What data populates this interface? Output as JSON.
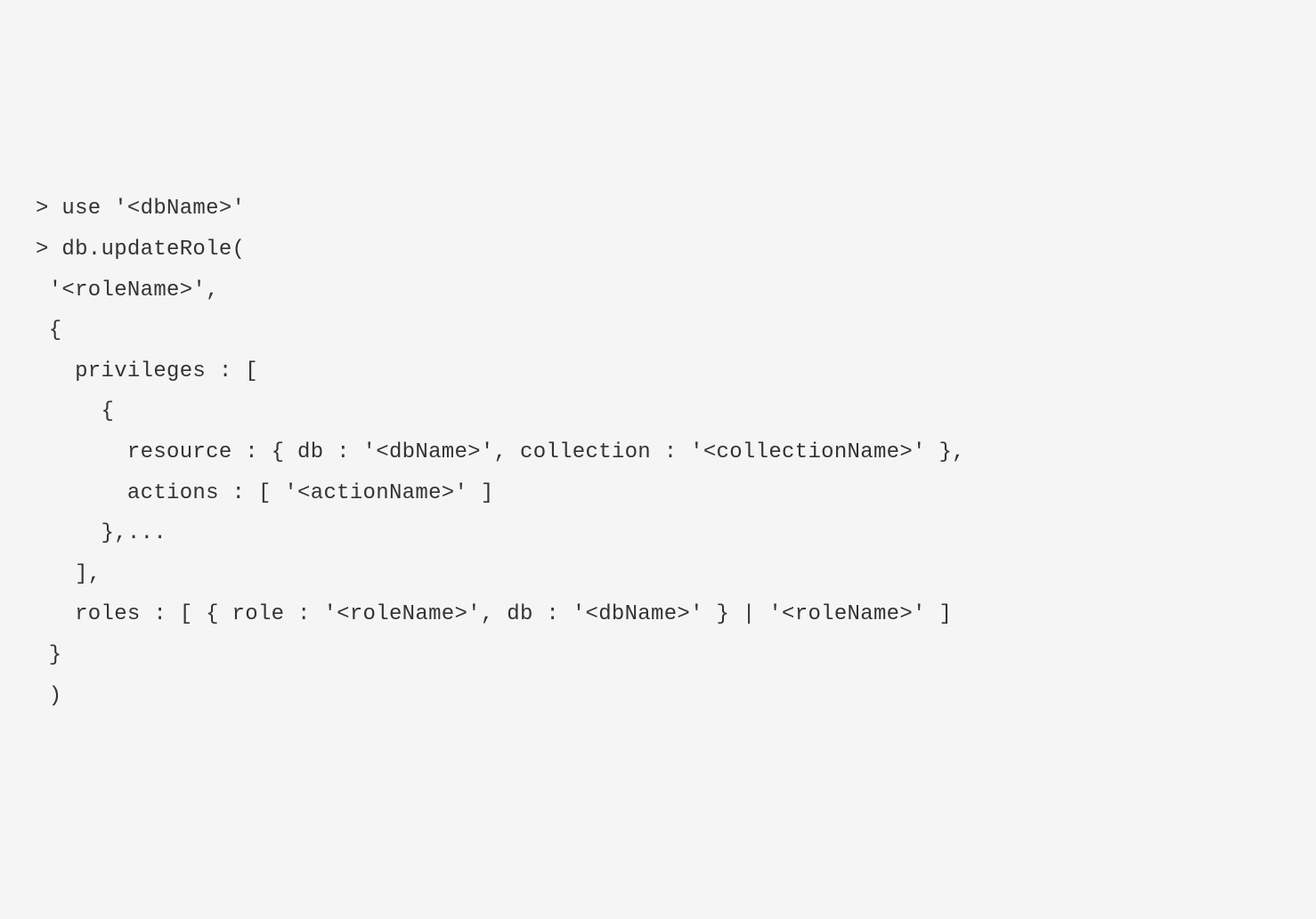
{
  "code": {
    "line1": "> use '<dbName>'",
    "line2": "> db.updateRole(",
    "line3": " '<roleName>',",
    "line4": " {",
    "line5": "   privileges : [",
    "line6": "     {",
    "line7": "       resource : { db : '<dbName>', collection : '<collectionName>' },",
    "line8": "       actions : [ '<actionName>' ]",
    "line9": "     },...",
    "line10": "   ],",
    "line11": "   roles : [ { role : '<roleName>', db : '<dbName>' } | '<roleName>' ]",
    "line12": " }",
    "line13": " )"
  }
}
